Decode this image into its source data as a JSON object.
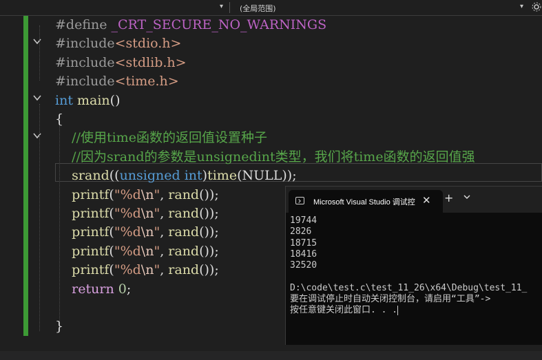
{
  "navbar": {
    "scope_label": "(全局范围)",
    "dropdown_glyph": "▾",
    "right_icon": "settings-icon"
  },
  "editor": {
    "lines": [
      {
        "id": "l1",
        "segments": [
          {
            "t": "#define ",
            "c": "pp"
          },
          {
            "t": "_CRT_SECURE_NO_WARNINGS",
            "c": "macro"
          }
        ]
      },
      {
        "id": "l2",
        "segments": [
          {
            "t": "#include",
            "c": "pp"
          },
          {
            "t": "<stdio.h>",
            "c": "inc"
          }
        ]
      },
      {
        "id": "l3",
        "segments": [
          {
            "t": "#include",
            "c": "pp"
          },
          {
            "t": "<stdlib.h>",
            "c": "inc"
          }
        ]
      },
      {
        "id": "l4",
        "segments": [
          {
            "t": "#include",
            "c": "pp"
          },
          {
            "t": "<time.h>",
            "c": "inc"
          }
        ]
      },
      {
        "id": "l5",
        "segments": [
          {
            "t": "int",
            "c": "kw"
          },
          {
            "t": " "
          },
          {
            "t": "main",
            "c": "fn"
          },
          {
            "t": "()"
          }
        ]
      },
      {
        "id": "l6",
        "segments": [
          {
            "t": "{"
          }
        ]
      },
      {
        "id": "l7",
        "segments": [
          {
            "t": "    "
          },
          {
            "t": "//使用time函数的返回值设置种子",
            "c": "cm"
          }
        ]
      },
      {
        "id": "l8",
        "segments": [
          {
            "t": "    "
          },
          {
            "t": "//因为srand的参数是unsignedint类型，我们将time函数的返回值强",
            "c": "cm"
          }
        ]
      },
      {
        "id": "l9",
        "segments": [
          {
            "t": "    "
          },
          {
            "t": "srand",
            "c": "fn"
          },
          {
            "t": "(("
          },
          {
            "t": "unsigned int",
            "c": "kw"
          },
          {
            "t": ")"
          },
          {
            "t": "time",
            "c": "fn"
          },
          {
            "t": "(NULL));"
          }
        ]
      },
      {
        "id": "l10",
        "segments": [
          {
            "t": "    "
          },
          {
            "t": "printf",
            "c": "fn"
          },
          {
            "t": "("
          },
          {
            "t": "\"%d",
            "c": "str"
          },
          {
            "t": "\\n",
            "c": "esc"
          },
          {
            "t": "\"",
            "c": "str"
          },
          {
            "t": ", "
          },
          {
            "t": "rand",
            "c": "fn"
          },
          {
            "t": "());"
          }
        ]
      },
      {
        "id": "l11",
        "segments": [
          {
            "t": "    "
          },
          {
            "t": "printf",
            "c": "fn"
          },
          {
            "t": "("
          },
          {
            "t": "\"%d",
            "c": "str"
          },
          {
            "t": "\\n",
            "c": "esc"
          },
          {
            "t": "\"",
            "c": "str"
          },
          {
            "t": ", "
          },
          {
            "t": "rand",
            "c": "fn"
          },
          {
            "t": "());"
          }
        ]
      },
      {
        "id": "l12",
        "segments": [
          {
            "t": "    "
          },
          {
            "t": "printf",
            "c": "fn"
          },
          {
            "t": "("
          },
          {
            "t": "\"%d",
            "c": "str"
          },
          {
            "t": "\\n",
            "c": "esc"
          },
          {
            "t": "\"",
            "c": "str"
          },
          {
            "t": ", "
          },
          {
            "t": "rand",
            "c": "fn"
          },
          {
            "t": "());"
          }
        ]
      },
      {
        "id": "l13",
        "segments": [
          {
            "t": "    "
          },
          {
            "t": "printf",
            "c": "fn"
          },
          {
            "t": "("
          },
          {
            "t": "\"%d",
            "c": "str"
          },
          {
            "t": "\\n",
            "c": "esc"
          },
          {
            "t": "\"",
            "c": "str"
          },
          {
            "t": ", "
          },
          {
            "t": "rand",
            "c": "fn"
          },
          {
            "t": "());"
          }
        ]
      },
      {
        "id": "l14",
        "segments": [
          {
            "t": "    "
          },
          {
            "t": "printf",
            "c": "fn"
          },
          {
            "t": "("
          },
          {
            "t": "\"%d",
            "c": "str"
          },
          {
            "t": "\\n",
            "c": "esc"
          },
          {
            "t": "\"",
            "c": "str"
          },
          {
            "t": ", "
          },
          {
            "t": "rand",
            "c": "fn"
          },
          {
            "t": "());"
          }
        ]
      },
      {
        "id": "l15",
        "segments": [
          {
            "t": "    "
          },
          {
            "t": "return",
            "c": "ret"
          },
          {
            "t": " "
          },
          {
            "t": "0",
            "c": "num"
          },
          {
            "t": ";"
          }
        ]
      },
      {
        "id": "l16",
        "segments": [
          {
            "t": ""
          }
        ]
      },
      {
        "id": "l17",
        "segments": [
          {
            "t": "}"
          }
        ]
      }
    ]
  },
  "console": {
    "title": "Microsoft Visual Studio 调试控",
    "close_glyph": "✕",
    "new_tab_glyph": "+",
    "menu_glyph": "⌄",
    "output": [
      "19744",
      "2826",
      "18715",
      "18416",
      "32520",
      "",
      "D:\\code\\test.c\\test_11_26\\x64\\Debug\\test_11_",
      "要在调试停止时自动关闭控制台，请启用“工具”->",
      "按任意键关闭此窗口. . ."
    ]
  }
}
